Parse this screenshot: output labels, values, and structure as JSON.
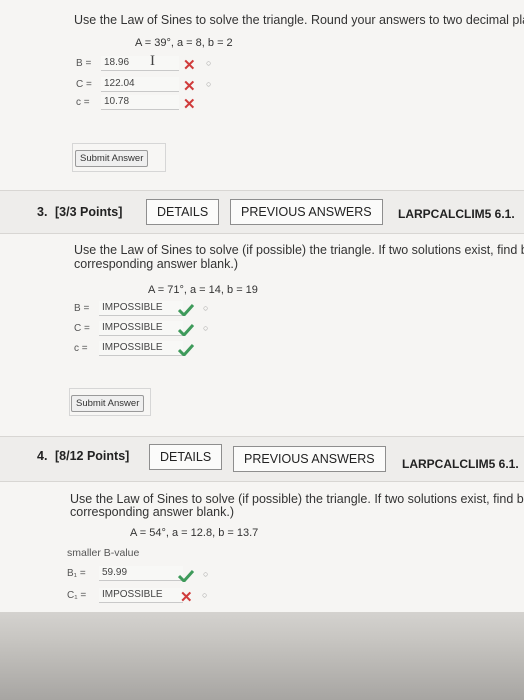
{
  "q2": {
    "prompt": "Use the Law of Sines to solve the triangle. Round your answers to two decimal places",
    "given": "A = 39°,  a = 8,  b = 2",
    "answers": [
      {
        "label": "B =",
        "value": "18.96",
        "status": "incorrect"
      },
      {
        "label": "C =",
        "value": "122.04",
        "status": "incorrect"
      },
      {
        "label": "c =",
        "value": "10.78",
        "status": "incorrect"
      }
    ],
    "submit_label": "Submit Answer"
  },
  "q3": {
    "number": "3.",
    "points": "[3/3 Points]",
    "details_label": "DETAILS",
    "previous_label": "PREVIOUS ANSWERS",
    "course_code": "LARPCALCLIM5 6.1.",
    "prompt_line1": "Use the Law of Sines to solve (if possible) the triangle. If two solutions exist, find both",
    "prompt_line2": "corresponding answer blank.)",
    "given": "A = 71°,  a = 14,  b = 19",
    "answers": [
      {
        "label": "B =",
        "value": "IMPOSSIBLE",
        "status": "correct"
      },
      {
        "label": "C =",
        "value": "IMPOSSIBLE",
        "status": "correct"
      },
      {
        "label": "c =",
        "value": "IMPOSSIBLE",
        "status": "correct"
      }
    ],
    "submit_label": "Submit Answer"
  },
  "q4": {
    "number": "4.",
    "points": "[8/12 Points]",
    "details_label": "DETAILS",
    "previous_label": "PREVIOUS ANSWERS",
    "course_code": "LARPCALCLIM5 6.1.",
    "prompt_line1": "Use the Law of Sines to solve (if possible) the triangle. If two solutions exist, find both",
    "prompt_line2": "corresponding answer blank.)",
    "given": "A = 54°,  a = 12.8,  b = 13.7",
    "sub_heading": "smaller B-value",
    "answers": [
      {
        "label": "B₁ =",
        "value": "59.99",
        "status": "correct"
      },
      {
        "label": "C₁ =",
        "value": "IMPOSSIBLE",
        "status": "incorrect"
      }
    ]
  },
  "colors": {
    "incorrect": "#d03b3b",
    "correct": "#3e9a5a"
  }
}
